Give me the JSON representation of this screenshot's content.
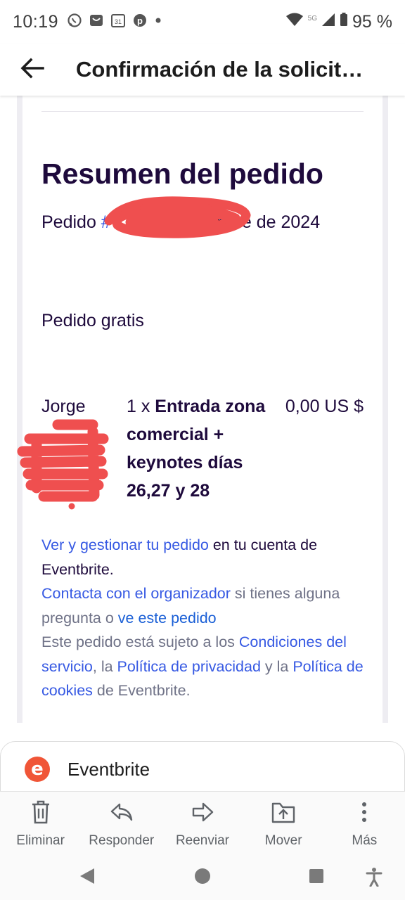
{
  "status_bar": {
    "time": "10:19",
    "battery": "95 %",
    "network": "5G"
  },
  "app_bar": {
    "title": "Confirmación de la solicit…"
  },
  "order": {
    "heading": "Resumen del pedido",
    "prefix": "Pedido ",
    "number_link": "#",
    "date_text": " - 26 de diciembre de 2024",
    "free_label": "Pedido gratis",
    "buyer_first_name": "Jorge",
    "item_qty": "1 x ",
    "item_name": "Entrada zona comercial + keynotes días 26,27 y 28",
    "price": "0,00 US $"
  },
  "footer": {
    "manage_link": "Ver y gestionar tu pedido",
    "manage_text": " en tu cuenta de Eventbrite.",
    "contact_link": "Contacta con el organizador",
    "contact_text": " si tienes alguna pregunta o ",
    "view_order_link": "ve este pedido",
    "terms_text": "Este pedido está sujeto a los ",
    "terms_link": "Condiciones del servicio",
    "comma_text": ", la ",
    "privacy_link": "Política de privacidad",
    "and_text": " y la ",
    "cookies_link": "Política de cookies",
    "end_text": " de Eventbrite."
  },
  "sender": {
    "logo_letter": "e",
    "name": "Eventbrite"
  },
  "actions": [
    {
      "label": "Eliminar",
      "icon": "trash-icon"
    },
    {
      "label": "Responder",
      "icon": "reply-icon"
    },
    {
      "label": "Reenviar",
      "icon": "forward-icon"
    },
    {
      "label": "Mover",
      "icon": "move-icon"
    },
    {
      "label": "Más",
      "icon": "more-vertical-icon"
    }
  ],
  "colors": {
    "link": "#3659e3",
    "heading": "#1e0a3c",
    "muted": "#6f7287",
    "brand": "#f05537",
    "redaction": "#ef4f4f"
  }
}
